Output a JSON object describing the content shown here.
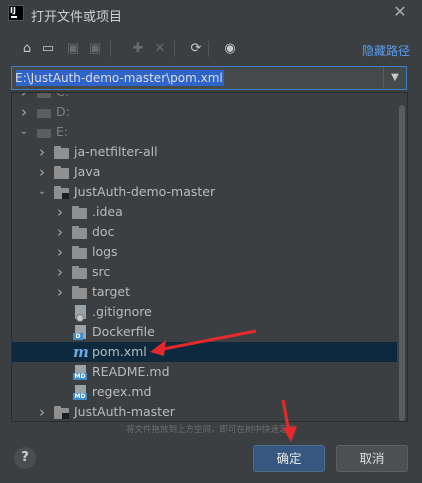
{
  "window": {
    "title": "打开文件或项目",
    "logo_text": "IJ"
  },
  "toolbar": {
    "items": [
      {
        "name": "home-icon",
        "glyph": "⌂"
      },
      {
        "name": "desktop-icon",
        "glyph": "▭"
      },
      {
        "name": "project-folder-icon",
        "glyph": "▣"
      },
      {
        "name": "module-folder-icon",
        "glyph": "▣"
      },
      {
        "name": "new-folder-icon",
        "glyph": "✚"
      },
      {
        "name": "delete-icon",
        "glyph": "✕"
      },
      {
        "name": "refresh-icon",
        "glyph": "⟳"
      },
      {
        "name": "show-hidden-icon",
        "glyph": "◉"
      }
    ],
    "hide_path_label": "隐藏路径"
  },
  "path_field": {
    "value": "E:\\JustAuth-demo-master\\pom.xml"
  },
  "tree": {
    "rows": [
      {
        "label": "C:",
        "type": "drive",
        "arrow": "collapsed",
        "level": 0
      },
      {
        "label": "D:",
        "type": "drive",
        "arrow": "collapsed",
        "level": 0
      },
      {
        "label": "E:",
        "type": "drive",
        "arrow": "expanded",
        "level": 0
      },
      {
        "label": "ja-netfilter-all",
        "type": "folder",
        "arrow": "collapsed",
        "level": 1
      },
      {
        "label": "Java",
        "type": "folder",
        "arrow": "collapsed",
        "level": 1
      },
      {
        "label": "JustAuth-demo-master",
        "type": "project",
        "arrow": "expanded",
        "level": 1
      },
      {
        "label": ".idea",
        "type": "folder",
        "arrow": "collapsed",
        "level": 2
      },
      {
        "label": "doc",
        "type": "folder",
        "arrow": "collapsed",
        "level": 2
      },
      {
        "label": "logs",
        "type": "folder",
        "arrow": "collapsed",
        "level": 2
      },
      {
        "label": "src",
        "type": "folder",
        "arrow": "collapsed",
        "level": 2
      },
      {
        "label": "target",
        "type": "folder",
        "arrow": "collapsed",
        "level": 2
      },
      {
        "label": ".gitignore",
        "type": "gitignore",
        "arrow": "none",
        "level": 2
      },
      {
        "label": "Dockerfile",
        "type": "docker",
        "arrow": "none",
        "level": 2
      },
      {
        "label": "pom.xml",
        "type": "maven",
        "arrow": "none",
        "level": 2,
        "selected": true
      },
      {
        "label": "README.md",
        "type": "markdown",
        "arrow": "none",
        "level": 2
      },
      {
        "label": "regex.md",
        "type": "markdown",
        "arrow": "none",
        "level": 2
      },
      {
        "label": "JustAuth-master",
        "type": "project",
        "arrow": "collapsed",
        "level": 1
      }
    ],
    "drag_hint": "将文件拖放到上方空间，即可在树中快速定位"
  },
  "buttons": {
    "help": "?",
    "ok": "确定",
    "cancel": "取消"
  },
  "colors": {
    "background": "#3c3f41",
    "accent_link": "#589df6",
    "selection": "#0d293e",
    "ok_button": "#365880",
    "annotation_arrow": "#e5292b"
  }
}
